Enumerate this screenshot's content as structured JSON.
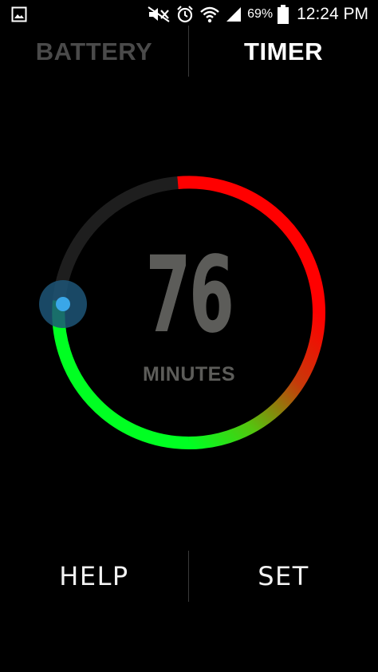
{
  "status_bar": {
    "battery_percent": "69%",
    "time": "12:24 PM",
    "icons": [
      "image-icon",
      "mute-icon",
      "alarm-icon",
      "wifi-icon",
      "signal-icon",
      "battery-icon"
    ]
  },
  "tabs": [
    {
      "label": "BATTERY",
      "active": false
    },
    {
      "label": "TIMER",
      "active": true
    }
  ],
  "dial": {
    "value": "76",
    "unit": "MINUTES",
    "colors": {
      "track": "#1e1e1e",
      "red": "#ff0000",
      "green": "#00ff22",
      "handle": "#3aa7e8",
      "handle_halo": "#1d5577",
      "text": "#5c5c59"
    }
  },
  "buttons": {
    "help": "HELP",
    "set": "SET"
  }
}
